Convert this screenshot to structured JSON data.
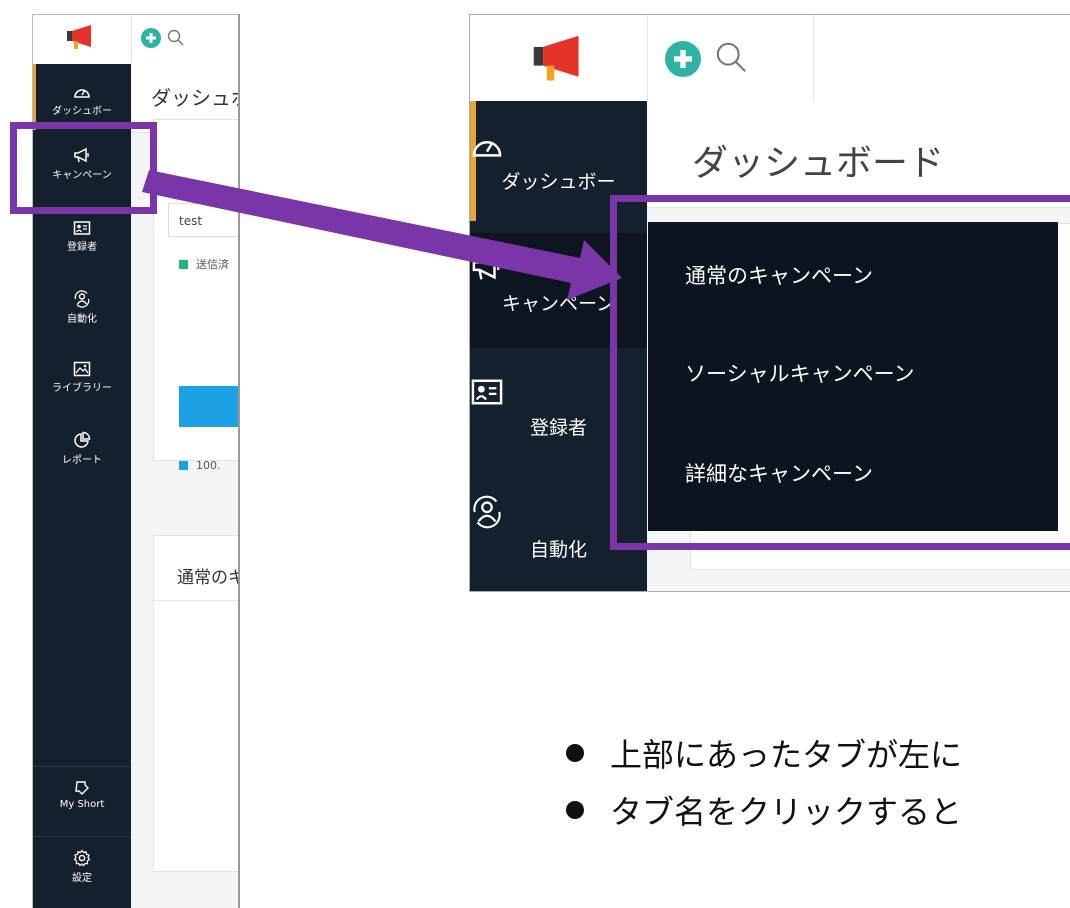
{
  "left_screenshot": {
    "page_title": "ダッシュボード",
    "sidebar": [
      {
        "label": "ダッシュボー",
        "icon": "speedometer-icon"
      },
      {
        "label": "キャンペーン",
        "icon": "megaphone-icon"
      },
      {
        "label": "登録者",
        "icon": "contact-card-icon"
      },
      {
        "label": "自動化",
        "icon": "automation-icon"
      },
      {
        "label": "ライブラリー",
        "icon": "image-icon"
      },
      {
        "label": "レポート",
        "icon": "pie-chart-icon"
      }
    ],
    "sidebar_bottom": [
      {
        "label": "My Short",
        "icon": "shortcut-icon"
      },
      {
        "label": "設定",
        "icon": "gear-icon"
      }
    ],
    "test_field_value": "test",
    "legend_sent": "送信済",
    "legend_value": "100.",
    "card_title": "通常のキャンペーン"
  },
  "right_screenshot": {
    "page_title": "ダッシュボード",
    "sidebar": [
      {
        "label": "ダッシュボー",
        "icon": "speedometer-icon"
      },
      {
        "label": "キャンペーン",
        "icon": "megaphone-icon"
      },
      {
        "label": "登録者",
        "icon": "contact-card-icon"
      },
      {
        "label": "自動化",
        "icon": "automation-icon"
      }
    ],
    "dropdown": [
      "通常のキャンペーン",
      "ソーシャルキャンペーン",
      "詳細なキャンペーン"
    ]
  },
  "bullets": [
    "上部にあったタブが左に",
    "タブ名をクリックすると"
  ],
  "colors": {
    "sidebar_bg": "#15202e",
    "active_accent": "#e8a33a",
    "highlight": "#7a35a8",
    "plus_button": "#2bb3a5",
    "chart_blue": "#1da1e6",
    "legend_green": "#2ab27b"
  }
}
